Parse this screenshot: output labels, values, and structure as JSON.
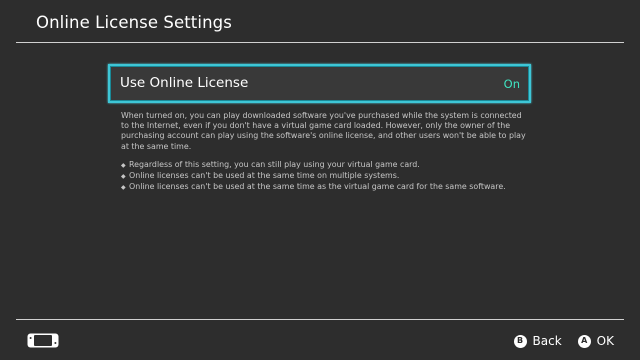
{
  "header": {
    "title": "Online License Settings"
  },
  "setting": {
    "label": "Use Online License",
    "value": "On",
    "value_color": "#3fe3c1",
    "focus_color": "#3ec6d6"
  },
  "description": {
    "paragraph": "When turned on, you can play downloaded software you've purchased while the system is connected to the Internet, even if you don't have a virtual game card loaded. However, only the owner of the purchasing account can play using the software's online license, and other users won't be able to play at the same time.",
    "bullets": [
      "Regardless of this setting, you can still play using your virtual game card.",
      "Online licenses can't be used at the same time on multiple systems.",
      "Online licenses can't be used at the same time as the virtual game card for the same software."
    ],
    "bullet_glyph": "◆"
  },
  "footer": {
    "console_icon": "console-handheld-icon",
    "back": {
      "button_glyph": "B",
      "label": "Back"
    },
    "ok": {
      "button_glyph": "A",
      "label": "OK"
    }
  }
}
